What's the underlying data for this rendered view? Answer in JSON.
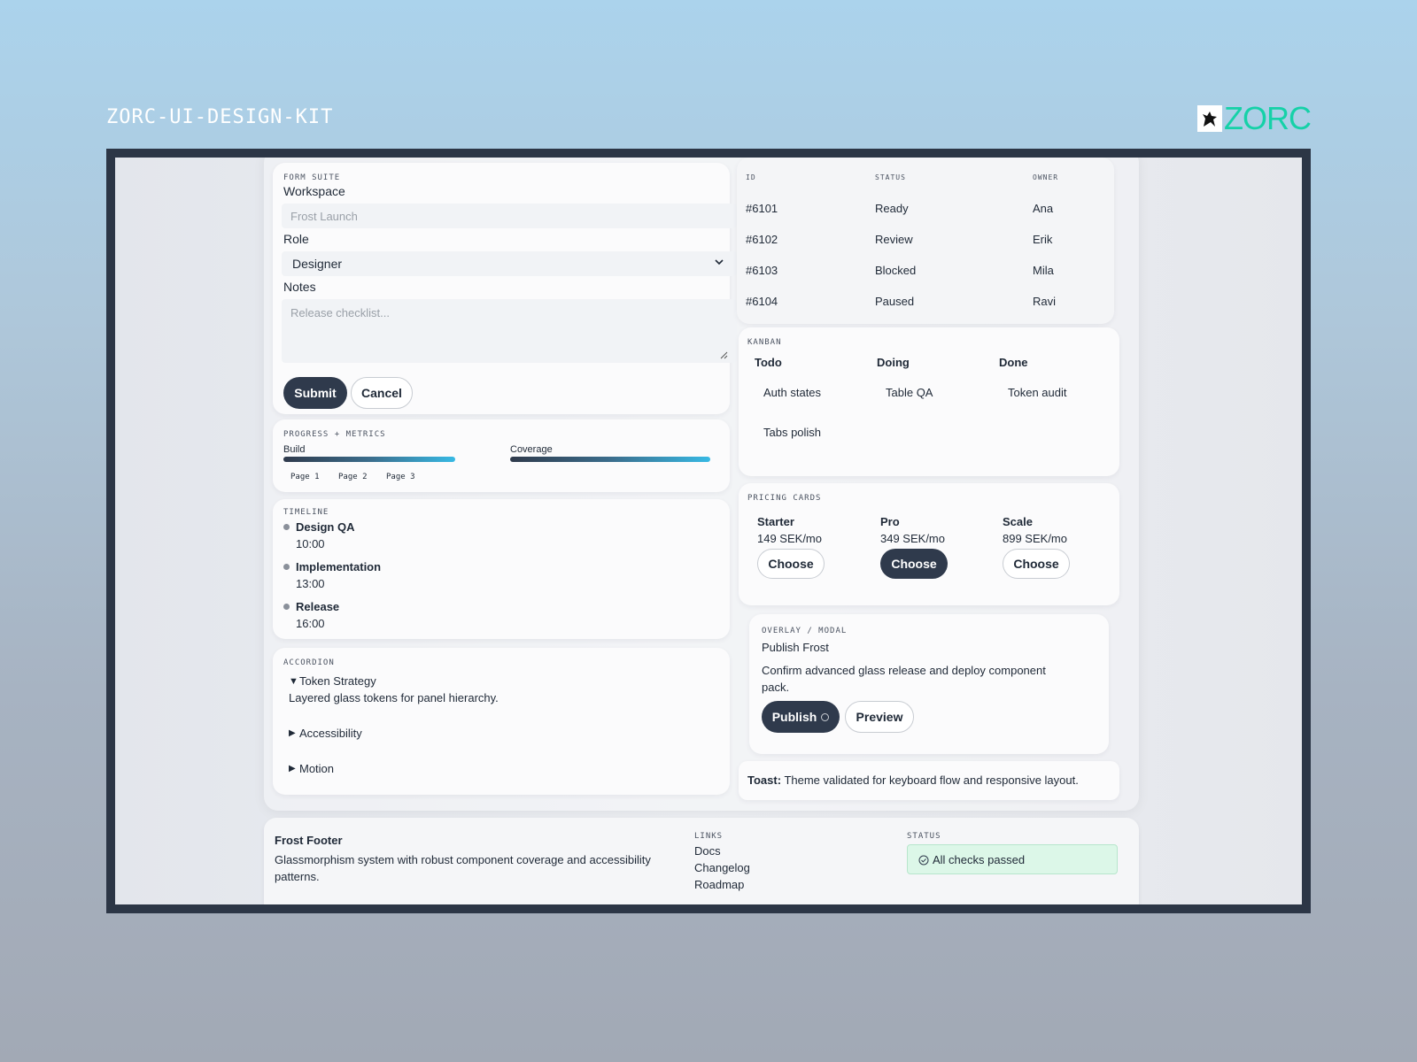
{
  "header": {
    "kit_title": "ZORC-UI-DESIGN-KIT",
    "brand": "ZORC"
  },
  "form": {
    "section": "FORM SUITE",
    "workspace_label": "Workspace",
    "workspace_placeholder": "Frost Launch",
    "role_label": "Role",
    "role_value": "Designer",
    "notes_label": "Notes",
    "notes_placeholder": "Release checklist...",
    "submit": "Submit",
    "cancel": "Cancel"
  },
  "progress": {
    "section": "PROGRESS + METRICS",
    "bars": [
      {
        "label": "Build"
      },
      {
        "label": "Coverage"
      }
    ],
    "pages": [
      "Page 1",
      "Page 2",
      "Page 3"
    ]
  },
  "timeline": {
    "section": "TIMELINE",
    "items": [
      {
        "title": "Design QA",
        "time": "10:00"
      },
      {
        "title": "Implementation",
        "time": "13:00"
      },
      {
        "title": "Release",
        "time": "16:00"
      }
    ]
  },
  "accordion": {
    "section": "ACCORDION",
    "items": [
      {
        "marker": "▼",
        "title": "Token Strategy",
        "body": "Layered glass tokens for panel hierarchy."
      },
      {
        "marker": "▶",
        "title": "Accessibility"
      },
      {
        "marker": "▶",
        "title": "Motion"
      }
    ]
  },
  "table": {
    "columns": [
      "ID",
      "STATUS",
      "OWNER"
    ],
    "rows": [
      [
        "#6101",
        "Ready",
        "Ana"
      ],
      [
        "#6102",
        "Review",
        "Erik"
      ],
      [
        "#6103",
        "Blocked",
        "Mila"
      ],
      [
        "#6104",
        "Paused",
        "Ravi"
      ]
    ]
  },
  "kanban": {
    "section": "KANBAN",
    "columns": [
      {
        "title": "Todo",
        "cards": [
          "Auth states",
          "Tabs polish"
        ]
      },
      {
        "title": "Doing",
        "cards": [
          "Table QA"
        ]
      },
      {
        "title": "Done",
        "cards": [
          "Token audit"
        ]
      }
    ]
  },
  "pricing": {
    "section": "PRICING CARDS",
    "plans": [
      {
        "name": "Starter",
        "price": "149 SEK/mo",
        "cta": "Choose"
      },
      {
        "name": "Pro",
        "price": "349 SEK/mo",
        "cta": "Choose"
      },
      {
        "name": "Scale",
        "price": "899 SEK/mo",
        "cta": "Choose"
      }
    ]
  },
  "modal": {
    "section": "OVERLAY / MODAL",
    "title": "Publish Frost",
    "body": "Confirm advanced glass release and deploy component pack.",
    "publish": "Publish",
    "preview": "Preview"
  },
  "toast": {
    "label": "Toast:",
    "text": "Theme validated for keyboard flow and responsive layout."
  },
  "footer": {
    "title": "Frost Footer",
    "description": "Glassmorphism system with robust component coverage and accessibility patterns.",
    "links_label": "LINKS",
    "links": [
      "Docs",
      "Changelog",
      "Roadmap"
    ],
    "status_label": "STATUS",
    "status_text": "All checks passed"
  },
  "colors": {
    "accent_dark": "#2f3a4c",
    "brand": "#15d1a8",
    "success_bg": "#dcf7e8"
  }
}
